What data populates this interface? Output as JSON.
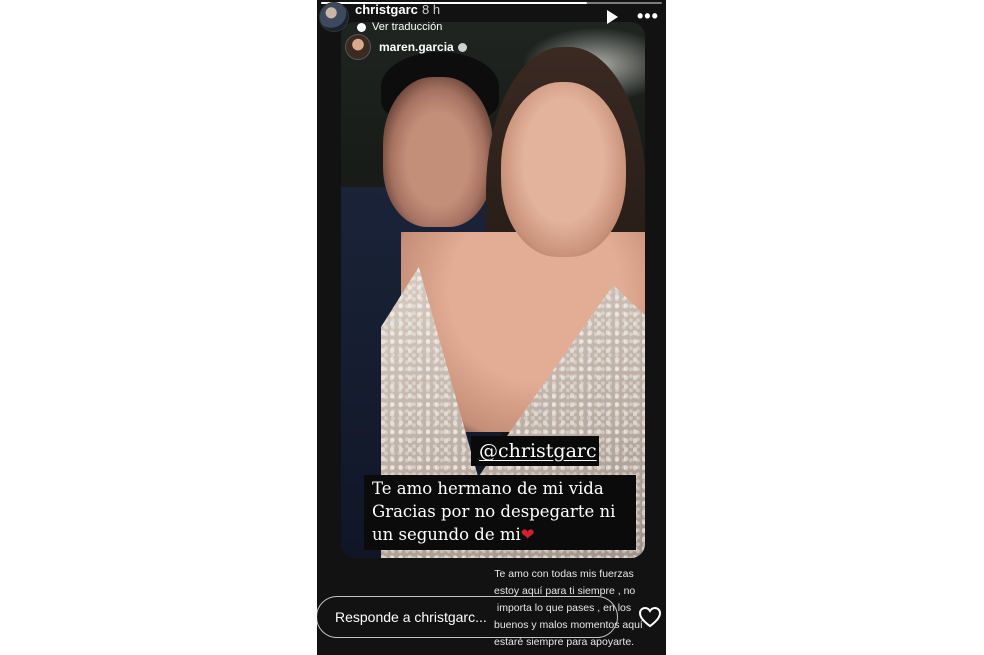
{
  "header": {
    "username": "christgarc",
    "time": "8 h",
    "translate_label": "Ver traducción",
    "reshared_username": "maren.garcia"
  },
  "sticker": {
    "mention": "@christgarc"
  },
  "caption": {
    "lines": [
      "Te amo hermano de mi vida",
      "Gracias por no despegarte ni",
      "un segundo de mi"
    ],
    "emoji": "❤"
  },
  "overlay_text": {
    "lines": [
      "Te amo con todas mis fuerzas",
      "estoy aquí para ti siempre , no",
      "importa lo que pases , en los",
      "buenos y malos momentos aquí",
      "estaré siempre para apoyarte."
    ]
  },
  "reply": {
    "placeholder": "Responde a christgarc..."
  },
  "icons": {
    "play": "play-icon",
    "more": "more-icon",
    "like": "heart-icon",
    "globe": "globe-icon"
  },
  "colors": {
    "background": "#121212",
    "heart_emoji": "#d01f2f"
  }
}
